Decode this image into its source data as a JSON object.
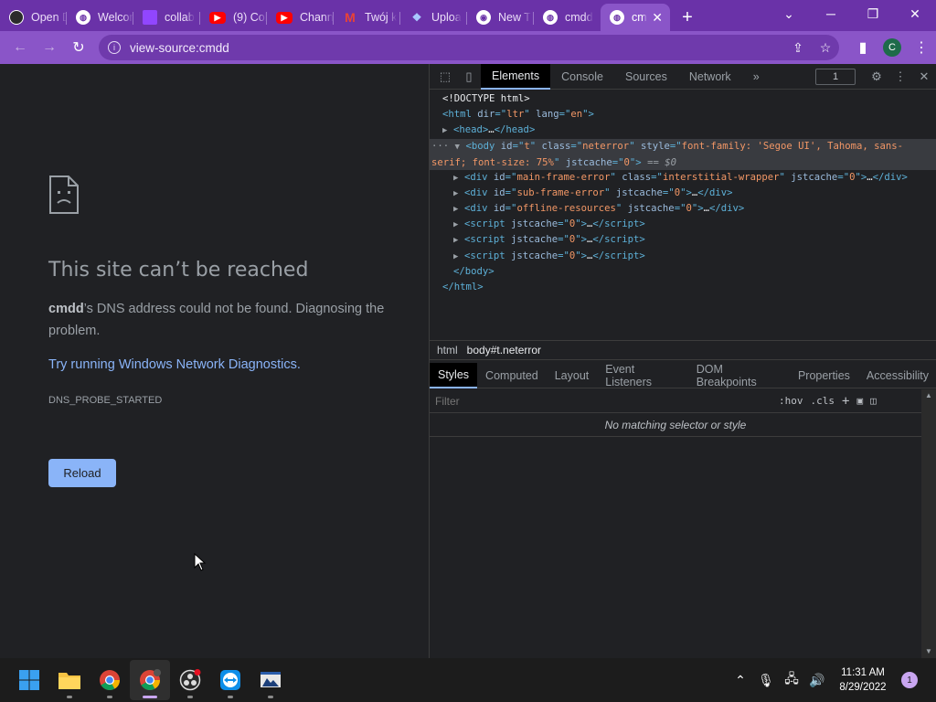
{
  "tabs": [
    {
      "title": "Open D",
      "favicon": "obs-icon",
      "color": "#2b2b2b"
    },
    {
      "title": "Welcome",
      "favicon": "chrome-world-icon",
      "color": "#ffffff"
    },
    {
      "title": "collab",
      "favicon": "twitch-icon",
      "color": "#9146ff"
    },
    {
      "title": "(9) Col",
      "favicon": "youtube-icon",
      "color": "#ff0000"
    },
    {
      "title": "Chann",
      "favicon": "youtube-icon",
      "color": "#ff0000"
    },
    {
      "title": "Twój k",
      "favicon": "gmail-icon",
      "color": "#ffffff"
    },
    {
      "title": "Uploa",
      "favicon": "dropbox-icon",
      "color": "#2f6fdc"
    },
    {
      "title": "New T",
      "favicon": "chrome-icon",
      "color": "#ffffff"
    },
    {
      "title": "cmdd",
      "favicon": "chrome-world-icon",
      "color": "#ffffff"
    },
    {
      "title": "cm",
      "favicon": "chrome-world-icon",
      "color": "#ffffff",
      "active": true
    }
  ],
  "omnibox": {
    "url": "view-source:cmdd"
  },
  "profile_initial": "C",
  "error": {
    "title": "This site can’t be reached",
    "host": "cmdd",
    "desc_rest": "’s DNS address could not be found. Diagnosing the problem.",
    "link": "Try running Windows Network Diagnostics.",
    "code": "DNS_PROBE_STARTED",
    "reload": "Reload"
  },
  "devtools": {
    "tabs": [
      "Elements",
      "Console",
      "Sources",
      "Network"
    ],
    "more": "»",
    "issue_count": "1",
    "crumbs": [
      "html",
      "body#t.neterror"
    ],
    "styles_tabs": [
      "Styles",
      "Computed",
      "Layout",
      "Event Listeners",
      "DOM Breakpoints",
      "Properties",
      "Accessibility"
    ],
    "filter_placeholder": "Filter",
    "hov": ":hov",
    "cls": ".cls",
    "no_match": "No matching selector or style"
  },
  "clock": {
    "time": "11:31 AM",
    "date": "8/29/2022"
  },
  "notification_count": "1"
}
